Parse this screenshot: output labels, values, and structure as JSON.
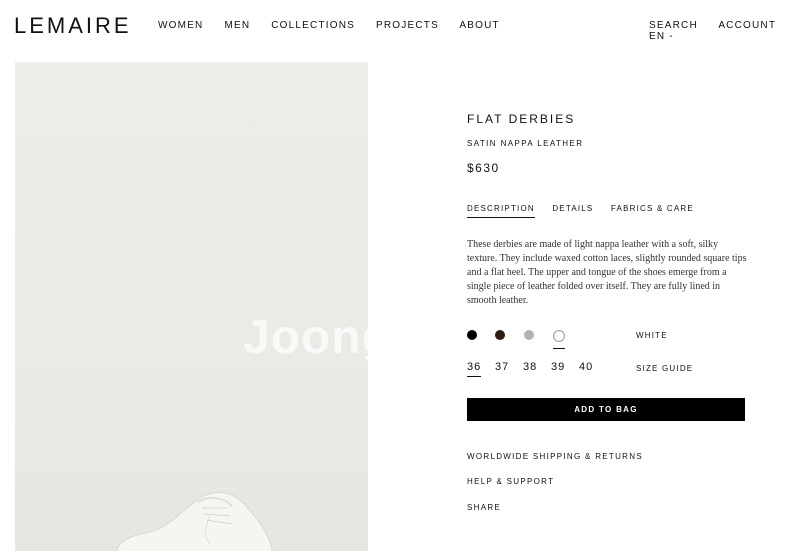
{
  "brand": "LEMAIRE",
  "nav": {
    "left": [
      "WOMEN",
      "MEN",
      "COLLECTIONS",
      "PROJECTS",
      "ABOUT"
    ],
    "right": [
      "SEARCH",
      "ACCOUNT",
      "EN -"
    ]
  },
  "photo": {
    "watermark": "Joong"
  },
  "product": {
    "title": "FLAT DERBIES",
    "material": "SATIN NAPPA LEATHER",
    "price": "$630"
  },
  "tabs": [
    {
      "label": "DESCRIPTION",
      "active": true
    },
    {
      "label": "DETAILS",
      "active": false
    },
    {
      "label": "FABRICS & CARE",
      "active": false
    }
  ],
  "description": "These derbies are made of light nappa leather with a soft, silky texture. They include waxed cotton laces, slightly rounded square tips and a flat heel. The upper and tongue of the shoes emerge from a single piece of leather folded over itself. They are fully lined in smooth leather.",
  "colors": {
    "swatches": [
      "#000000",
      "#2e1d14",
      "#b3b3b3",
      "#ffffff"
    ],
    "selected_index": 3,
    "selected_label": "WHITE"
  },
  "sizes": {
    "options": [
      "36",
      "37",
      "38",
      "39",
      "40"
    ],
    "selected": "36",
    "guide_label": "SIZE GUIDE"
  },
  "add_to_bag": "ADD TO BAG",
  "links": [
    "WORLDWIDE SHIPPING & RETURNS",
    "HELP & SUPPORT",
    "SHARE"
  ]
}
